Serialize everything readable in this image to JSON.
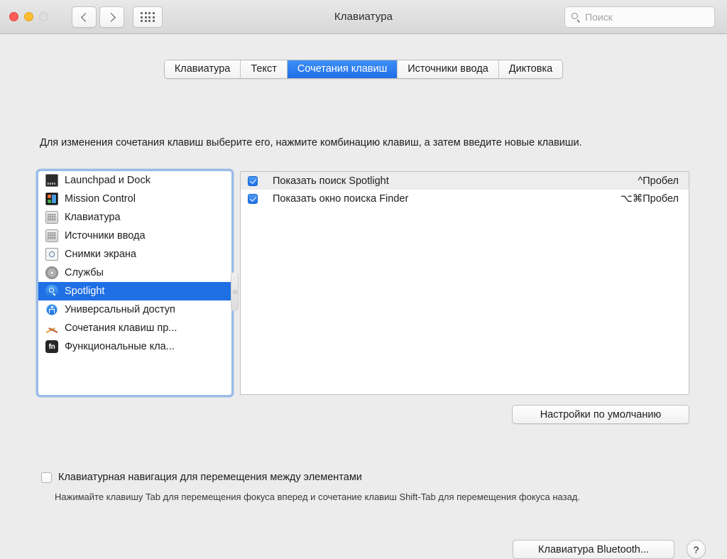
{
  "window": {
    "title": "Клавиатура",
    "traffic_lights": [
      "close",
      "minimize",
      "zoom"
    ],
    "nav_back_icon": "chevron-left-icon",
    "nav_forward_icon": "chevron-right-icon",
    "grid_icon": "show-all-grid-icon"
  },
  "search": {
    "placeholder": "Поиск",
    "icon": "search-icon"
  },
  "tabs": [
    {
      "label": "Клавиатура",
      "active": false
    },
    {
      "label": "Текст",
      "active": false
    },
    {
      "label": "Сочетания клавиш",
      "active": true
    },
    {
      "label": "Источники ввода",
      "active": false
    },
    {
      "label": "Диктовка",
      "active": false
    }
  ],
  "instructions": "Для изменения сочетания клавиш выберите его, нажмите комбинацию клавиш, а затем введите новые клавиши.",
  "categories": [
    {
      "label": "Launchpad и Dock",
      "icon": "launchpad-dock-icon",
      "selected": false
    },
    {
      "label": "Mission Control",
      "icon": "mission-control-icon",
      "selected": false
    },
    {
      "label": "Клавиатура",
      "icon": "keyboard-icon",
      "selected": false
    },
    {
      "label": "Источники ввода",
      "icon": "keyboard-icon",
      "selected": false
    },
    {
      "label": "Снимки экрана",
      "icon": "screenshot-icon",
      "selected": false
    },
    {
      "label": "Службы",
      "icon": "services-gear-icon",
      "selected": false
    },
    {
      "label": "Spotlight",
      "icon": "spotlight-icon",
      "selected": true
    },
    {
      "label": "Универсальный доступ",
      "icon": "accessibility-icon",
      "selected": false
    },
    {
      "label": "Сочетания клавиш пр...",
      "icon": "app-shortcuts-icon",
      "selected": false
    },
    {
      "label": "Функциональные кла...",
      "icon": "fn-key-icon",
      "selected": false
    }
  ],
  "shortcuts": [
    {
      "checked": true,
      "label": "Показать поиск Spotlight",
      "keys": "^Пробел"
    },
    {
      "checked": true,
      "label": "Показать окно поиска Finder",
      "keys": "⌥⌘Пробел"
    }
  ],
  "buttons": {
    "defaults": "Настройки по умолчанию",
    "bluetooth": "Клавиатура Bluetooth...",
    "help": "?"
  },
  "full_keyboard_access": {
    "label": "Клавиатурная навигация для перемещения между элементами",
    "checked": false,
    "hint": "Нажимайте клавишу Tab для перемещения фокуса вперед и сочетание клавиш Shift-Tab для перемещения фокуса назад."
  },
  "colors": {
    "accent_blue": "#1f6fe5",
    "tab_active_blue": "#3f90f7",
    "window_bg": "#ececec",
    "panel_bg": "#ffffff"
  }
}
